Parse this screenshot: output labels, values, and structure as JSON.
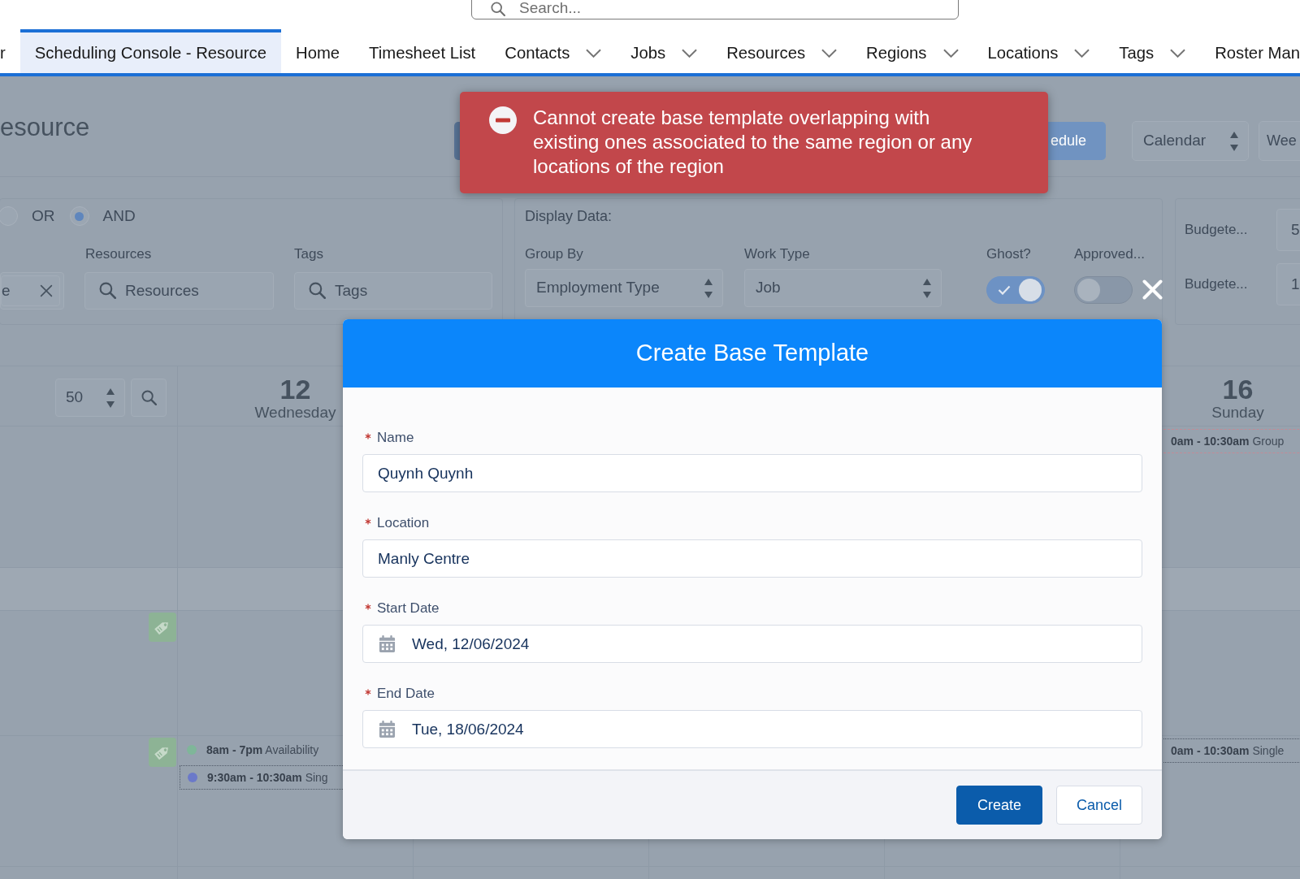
{
  "search": {
    "placeholder": "Search..."
  },
  "nav": {
    "items": [
      {
        "label": "r",
        "selected": false,
        "dropdown": false
      },
      {
        "label": "Scheduling Console - Resource",
        "selected": true,
        "dropdown": false
      },
      {
        "label": "Home",
        "selected": false,
        "dropdown": false
      },
      {
        "label": "Timesheet List",
        "selected": false,
        "dropdown": false
      },
      {
        "label": "Contacts",
        "selected": false,
        "dropdown": true
      },
      {
        "label": "Jobs",
        "selected": false,
        "dropdown": true
      },
      {
        "label": "Resources",
        "selected": false,
        "dropdown": true
      },
      {
        "label": "Regions",
        "selected": false,
        "dropdown": true
      },
      {
        "label": "Locations",
        "selected": false,
        "dropdown": true
      },
      {
        "label": "Tags",
        "selected": false,
        "dropdown": true
      },
      {
        "label": "Roster Man",
        "selected": false,
        "dropdown": false
      }
    ]
  },
  "page": {
    "title": "esource"
  },
  "toolbar": {
    "print_button": "edule",
    "view_select": "Calendar",
    "range_select": "Wee"
  },
  "toast": {
    "message": "Cannot create base template overlapping with existing ones associated to the same region or any locations of the region"
  },
  "filters": {
    "logic": [
      {
        "label": "OR",
        "selected": false
      },
      {
        "label": "AND",
        "selected": true
      }
    ],
    "chip": {
      "label": "e"
    },
    "resources": {
      "label": "Resources",
      "placeholder": "Resources"
    },
    "tags": {
      "label": "Tags",
      "placeholder": "Tags"
    }
  },
  "display_data": {
    "title": "Display Data:",
    "selects": [
      {
        "label": "Group By",
        "value": "Employment Type"
      },
      {
        "label": "Work Type",
        "value": "Job"
      }
    ],
    "toggles": [
      {
        "label": "Ghost?",
        "on": true
      },
      {
        "label": "Approved...",
        "on": false
      }
    ]
  },
  "budget": [
    {
      "label": "Budgete...",
      "value": "5"
    },
    {
      "label": "Budgete...",
      "value": "1"
    }
  ],
  "calendar": {
    "page_size": "50",
    "days": [
      {
        "number": "12",
        "name": "Wednesday"
      },
      {
        "number": "16",
        "name": "Sunday"
      }
    ],
    "rows": [
      {
        "kind": "resource",
        "tagged": false,
        "sunday": [
          {
            "kind": "group",
            "time": "0am - 10:30am",
            "title": "Group"
          }
        ]
      },
      {
        "kind": "band",
        "tagged": false
      },
      {
        "kind": "resource",
        "tagged": true
      },
      {
        "kind": "resource",
        "tagged": true,
        "wednesday": [
          {
            "kind": "availability",
            "time": "8am - 7pm",
            "title": "Availability",
            "color": "#7fb699"
          },
          {
            "kind": "single",
            "time": "9:30am - 10:30am",
            "title": "Sing",
            "color": "#6b79c9"
          }
        ],
        "sunday": [
          {
            "kind": "single",
            "time": "0am - 10:30am",
            "title": "Single"
          }
        ]
      }
    ]
  },
  "modal": {
    "title": "Create Base Template",
    "fields": [
      {
        "label": "Name",
        "required": true,
        "kind": "text",
        "value": "Quynh Quynh"
      },
      {
        "label": "Location",
        "required": true,
        "kind": "text",
        "value": "Manly Centre"
      },
      {
        "label": "Start Date",
        "required": true,
        "kind": "date",
        "value": "Wed, 12/06/2024"
      },
      {
        "label": "End Date",
        "required": true,
        "kind": "date",
        "value": "Tue, 18/06/2024"
      }
    ],
    "buttons": [
      {
        "label": "Create",
        "kind": "primary"
      },
      {
        "label": "Cancel",
        "kind": "neutral"
      }
    ]
  }
}
